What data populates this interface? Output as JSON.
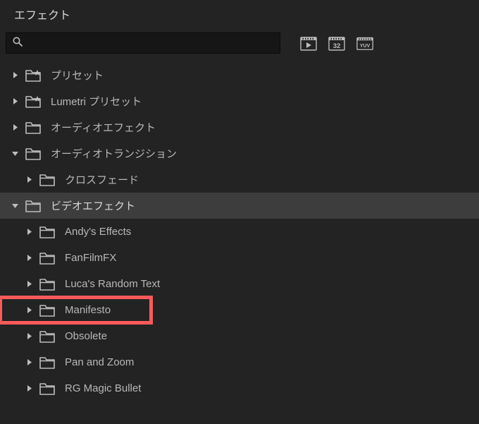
{
  "panel": {
    "title": "エフェクト"
  },
  "search": {
    "placeholder": ""
  },
  "tree": [
    {
      "label": "プリセット",
      "expanded": false,
      "level": 0,
      "preset": true,
      "selected": false,
      "highlighted": false
    },
    {
      "label": "Lumetri プリセット",
      "expanded": false,
      "level": 0,
      "preset": true,
      "selected": false,
      "highlighted": false
    },
    {
      "label": "オーディオエフェクト",
      "expanded": false,
      "level": 0,
      "preset": false,
      "selected": false,
      "highlighted": false
    },
    {
      "label": "オーディオトランジション",
      "expanded": true,
      "level": 0,
      "preset": false,
      "selected": false,
      "highlighted": false
    },
    {
      "label": "クロスフェード",
      "expanded": false,
      "level": 1,
      "preset": false,
      "selected": false,
      "highlighted": false
    },
    {
      "label": "ビデオエフェクト",
      "expanded": true,
      "level": 0,
      "preset": false,
      "selected": true,
      "highlighted": false
    },
    {
      "label": "Andy's Effects",
      "expanded": false,
      "level": 1,
      "preset": false,
      "selected": false,
      "highlighted": false
    },
    {
      "label": "FanFilmFX",
      "expanded": false,
      "level": 1,
      "preset": false,
      "selected": false,
      "highlighted": false
    },
    {
      "label": "Luca's Random Text",
      "expanded": false,
      "level": 1,
      "preset": false,
      "selected": false,
      "highlighted": false
    },
    {
      "label": "Manifesto",
      "expanded": false,
      "level": 1,
      "preset": false,
      "selected": false,
      "highlighted": true
    },
    {
      "label": "Obsolete",
      "expanded": false,
      "level": 1,
      "preset": false,
      "selected": false,
      "highlighted": false
    },
    {
      "label": "Pan and Zoom",
      "expanded": false,
      "level": 1,
      "preset": false,
      "selected": false,
      "highlighted": false
    },
    {
      "label": "RG Magic Bullet",
      "expanded": false,
      "level": 1,
      "preset": false,
      "selected": false,
      "highlighted": false
    }
  ]
}
